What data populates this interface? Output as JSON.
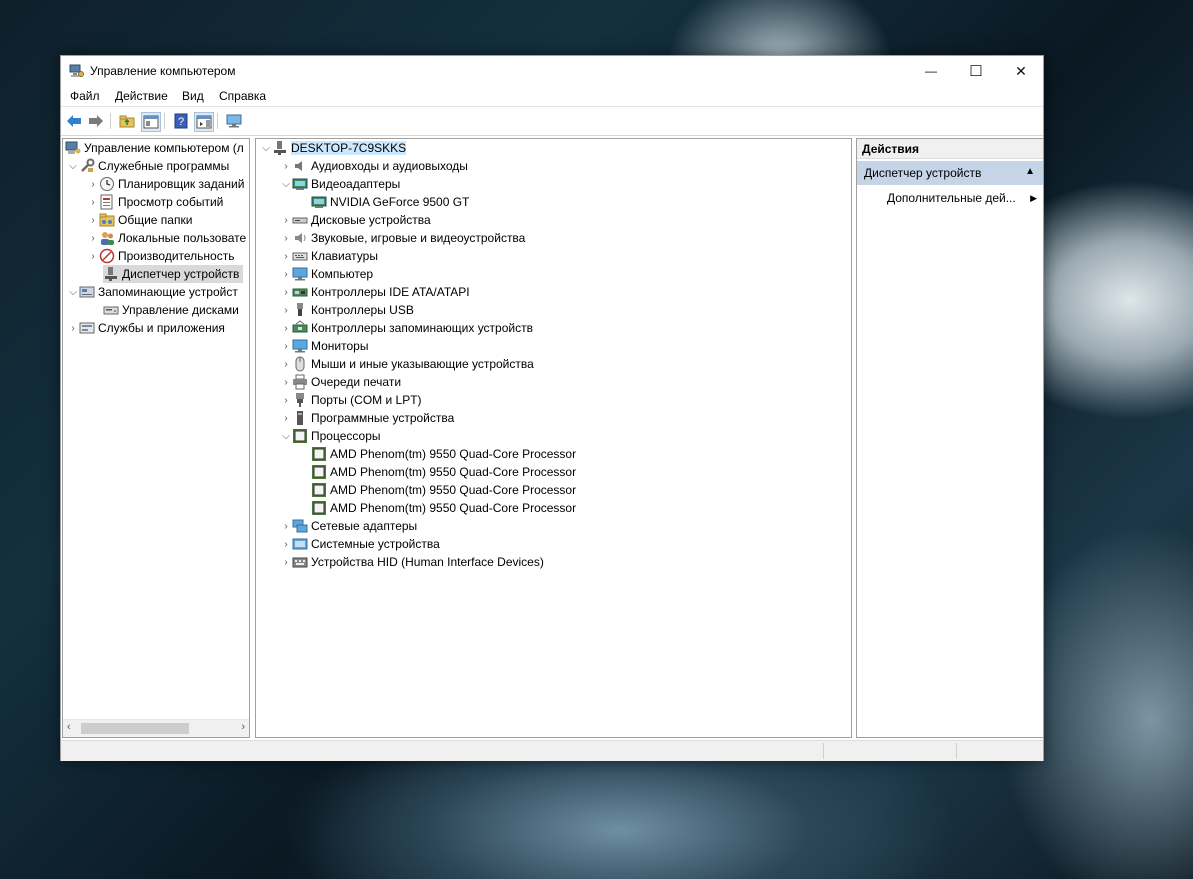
{
  "window": {
    "title": "Управление компьютером",
    "controls": {
      "minimize": "—",
      "maximize": "☐",
      "close": "✕"
    }
  },
  "menu": [
    "Файл",
    "Действие",
    "Вид",
    "Справка"
  ],
  "toolbar": [
    "back-icon",
    "forward-icon",
    "up-folder-icon",
    "properties-icon",
    "help-icon",
    "action-pane-icon",
    "monitor-icon"
  ],
  "left_tree": {
    "root": "Управление компьютером (л",
    "system_tools": "Служебные программы",
    "system_tools_items": [
      "Планировщик заданий",
      "Просмотр событий",
      "Общие папки",
      "Локальные пользовате",
      "Производительность",
      "Диспетчер устройств"
    ],
    "storage": "Запоминающие устройст",
    "storage_items": [
      "Управление дисками"
    ],
    "services": "Службы и приложения"
  },
  "device_tree": {
    "computer": "DESKTOP-7C9SKKS",
    "categories": [
      {
        "label": "Аудиовходы и аудиовыходы",
        "expanded": false,
        "icon": "audio-icon"
      },
      {
        "label": "Видеоадаптеры",
        "expanded": true,
        "icon": "display-adapter-icon",
        "children": [
          "NVIDIA GeForce 9500 GT"
        ]
      },
      {
        "label": "Дисковые устройства",
        "expanded": false,
        "icon": "disk-icon"
      },
      {
        "label": "Звуковые, игровые и видеоустройства",
        "expanded": false,
        "icon": "sound-icon"
      },
      {
        "label": "Клавиатуры",
        "expanded": false,
        "icon": "keyboard-icon"
      },
      {
        "label": "Компьютер",
        "expanded": false,
        "icon": "computer-icon"
      },
      {
        "label": "Контроллеры IDE ATA/ATAPI",
        "expanded": false,
        "icon": "ide-controller-icon"
      },
      {
        "label": "Контроллеры USB",
        "expanded": false,
        "icon": "usb-icon"
      },
      {
        "label": "Контроллеры запоминающих устройств",
        "expanded": false,
        "icon": "storage-controller-icon"
      },
      {
        "label": "Мониторы",
        "expanded": false,
        "icon": "monitor-icon"
      },
      {
        "label": "Мыши и иные указывающие устройства",
        "expanded": false,
        "icon": "mouse-icon"
      },
      {
        "label": "Очереди печати",
        "expanded": false,
        "icon": "printer-icon"
      },
      {
        "label": "Порты (COM и LPT)",
        "expanded": false,
        "icon": "port-icon"
      },
      {
        "label": "Программные устройства",
        "expanded": false,
        "icon": "software-device-icon"
      },
      {
        "label": "Процессоры",
        "expanded": true,
        "icon": "processor-icon",
        "children": [
          "AMD Phenom(tm) 9550 Quad-Core Processor",
          "AMD Phenom(tm) 9550 Quad-Core Processor",
          "AMD Phenom(tm) 9550 Quad-Core Processor",
          "AMD Phenom(tm) 9550 Quad-Core Processor"
        ]
      },
      {
        "label": "Сетевые адаптеры",
        "expanded": false,
        "icon": "network-icon"
      },
      {
        "label": "Системные устройства",
        "expanded": false,
        "icon": "system-device-icon"
      },
      {
        "label": "Устройства HID (Human Interface Devices)",
        "expanded": false,
        "icon": "hid-icon"
      }
    ]
  },
  "actions": {
    "header": "Действия",
    "section": "Диспетчер устройств",
    "item": "Дополнительные дей..."
  },
  "colors": {
    "accent_selection": "#cce8ff",
    "actions_section": "#c5d4e7"
  }
}
